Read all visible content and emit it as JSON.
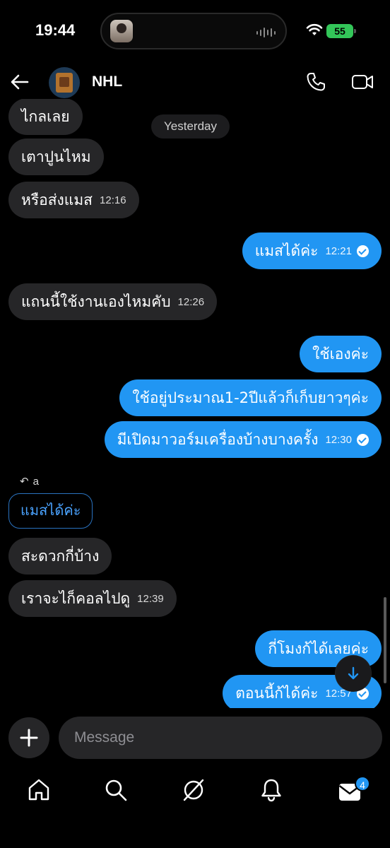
{
  "status_bar": {
    "time": "19:44",
    "battery": "55"
  },
  "header": {
    "name": "NHL"
  },
  "chat": {
    "date_divider": "Yesterday",
    "messages": [
      {
        "dir": "in",
        "text": "ไกลเลย",
        "time": ""
      },
      {
        "dir": "in",
        "text": "เตาปูนไหม",
        "time": ""
      },
      {
        "dir": "in",
        "text": "หรือส่งแมส",
        "time": "12:16"
      },
      {
        "dir": "out",
        "text": "แมสได้ค่ะ",
        "time": "12:21"
      },
      {
        "dir": "in",
        "text": "แถนนี้ใช้งานเองไหมคับ",
        "time": "12:26"
      },
      {
        "dir": "out",
        "text": "ใช้เองค่ะ",
        "time": ""
      },
      {
        "dir": "out",
        "text": "ใช้อยู่ประมาณ1-2ปีแล้วก็เก็บยาวๆค่ะ",
        "time": ""
      },
      {
        "dir": "out",
        "text": "มีเปิดมาวอร์มเครื่องบ้างบางครั้ง",
        "time": "12:30"
      },
      {
        "dir": "in",
        "text": "สะดวกกี่บ้าง",
        "time": ""
      },
      {
        "dir": "in",
        "text": "เราจะไก็คอลไปดู",
        "time": "12:39"
      },
      {
        "dir": "out",
        "text": "กี่โมงก้ได้เลยค่ะ",
        "time": ""
      },
      {
        "dir": "out",
        "text": "ตอนนี้ก้ได้ค่ะ",
        "time": "12:57"
      }
    ],
    "reply": {
      "label": "a",
      "quote": "แมสได้ค่ะ"
    }
  },
  "composer": {
    "placeholder": "Message"
  },
  "nav": {
    "items": [
      "home-icon",
      "search-icon",
      "explore-icon",
      "notifications-icon",
      "inbox-icon"
    ],
    "inbox_badge": "4"
  },
  "colors": {
    "bubble_out": "#2196f3",
    "bubble_in": "#262628",
    "background": "#000000"
  }
}
